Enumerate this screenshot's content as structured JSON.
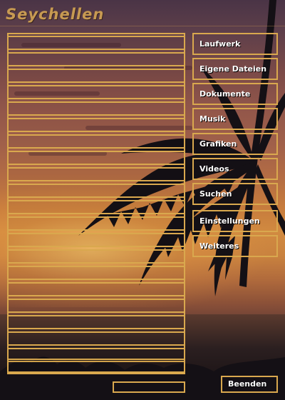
{
  "app": {
    "title": "Seychellen",
    "accent_color": "#d9a84e"
  },
  "list": {
    "rows": [
      "",
      "",
      "",
      "",
      "",
      "",
      "",
      "",
      "",
      "",
      "",
      "",
      "",
      "",
      "",
      "",
      "",
      "",
      "",
      "",
      ""
    ]
  },
  "menu": {
    "items": [
      {
        "label": "Laufwerk"
      },
      {
        "label": "Eigene Dateien"
      },
      {
        "label": "Dokumente"
      },
      {
        "label": "Musik"
      },
      {
        "label": "Grafiken"
      },
      {
        "label": "Videos"
      },
      {
        "label": "Suchen"
      },
      {
        "label": "Einstellungen"
      },
      {
        "label": "Weiteres"
      }
    ]
  },
  "footer": {
    "field_value": "",
    "quit_label": "Beenden"
  }
}
